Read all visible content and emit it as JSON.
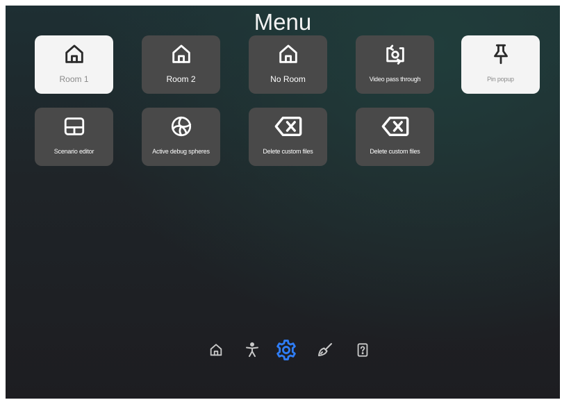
{
  "title": "Menu",
  "colors": {
    "tile_dark": "#494949",
    "tile_light": "#f4f4f4",
    "nav_icon": "#c9c9c9",
    "nav_active": "#2f7df6"
  },
  "tiles": [
    {
      "label": "Room 1",
      "icon": "home-icon",
      "selected": true
    },
    {
      "label": "Room 2",
      "icon": "home-icon",
      "selected": false
    },
    {
      "label": "No Room",
      "icon": "home-icon",
      "selected": false
    },
    {
      "label": "Video pass through",
      "icon": "camera-rotate-icon",
      "selected": false
    },
    {
      "label": "Pin popup",
      "icon": "pin-icon",
      "selected": true
    },
    {
      "label": "Scenario editor",
      "icon": "layout-icon",
      "selected": false
    },
    {
      "label": "Active debug spheres",
      "icon": "sphere-icon",
      "selected": false
    },
    {
      "label": "Delete custom files",
      "icon": "backspace-icon",
      "selected": false
    },
    {
      "label": "Delete custom files",
      "icon": "backspace-icon",
      "selected": false
    }
  ],
  "nav": [
    {
      "icon": "home-icon",
      "active": false
    },
    {
      "icon": "person-icon",
      "active": false
    },
    {
      "icon": "gear-icon",
      "active": true
    },
    {
      "icon": "brush-icon",
      "active": false
    },
    {
      "icon": "help-icon",
      "active": false
    }
  ]
}
